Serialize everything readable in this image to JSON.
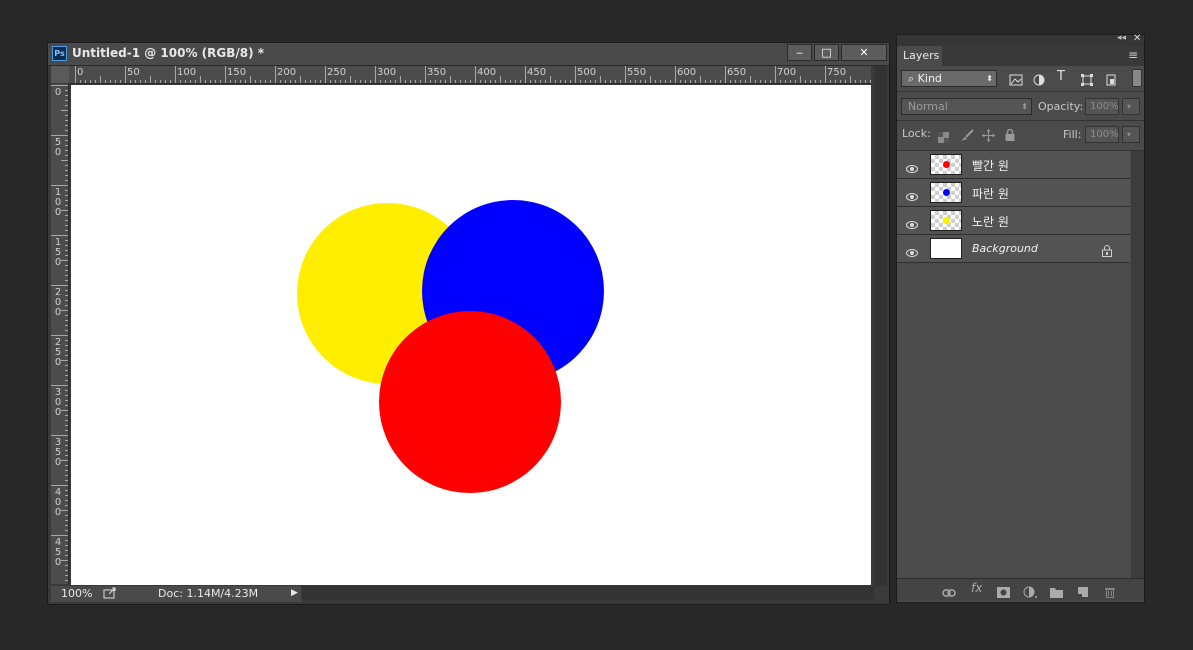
{
  "document": {
    "title": "Untitled-1 @ 100% (RGB/8) *",
    "app_icon": "Ps",
    "controls": [
      "minimize-icon",
      "restore-icon",
      "close-icon"
    ],
    "control_glyphs": {
      "minimize": "‒",
      "restore": "□",
      "close": "✕"
    }
  },
  "ruler": {
    "horizontal_labels": [
      "0",
      "50",
      "100",
      "150",
      "200",
      "250",
      "300",
      "350",
      "400",
      "450",
      "500",
      "550",
      "600",
      "650",
      "700",
      "750"
    ],
    "vertical_labels": [
      "0",
      "50",
      "100",
      "150",
      "200",
      "250",
      "300",
      "350",
      "400",
      "450"
    ]
  },
  "canvas": {
    "background": "#ffffff",
    "shapes": [
      {
        "name": "yellow-circle",
        "color": "#ffee00"
      },
      {
        "name": "blue-circle",
        "color": "#0000ff"
      },
      {
        "name": "red-circle",
        "color": "#ff0000"
      }
    ]
  },
  "status": {
    "zoom": "100%",
    "doc_info": "Doc: 1.14M/4.23M",
    "arrow": "▶"
  },
  "layers_panel": {
    "tab_label": "Layers",
    "filter_kind": "Kind",
    "filter_glyph": "⌕",
    "blend_mode": "Normal",
    "opacity_label": "Opacity:",
    "opacity_value": "100%",
    "lock_label": "Lock:",
    "fill_label": "Fill:",
    "fill_value": "100%",
    "layers": [
      {
        "name": "빨간 원",
        "dot_color": "#ff0000"
      },
      {
        "name": "파란 원",
        "dot_color": "#0000ff"
      },
      {
        "name": "노란 원",
        "dot_color": "#ffee00"
      },
      {
        "name": "Background",
        "locked": true
      }
    ],
    "header_glyphs": {
      "collapse": "◂◂",
      "close": "✕",
      "menu": "≡"
    }
  },
  "colors": {
    "app_background": "#282828",
    "panel_background": "#4b4b4b"
  }
}
